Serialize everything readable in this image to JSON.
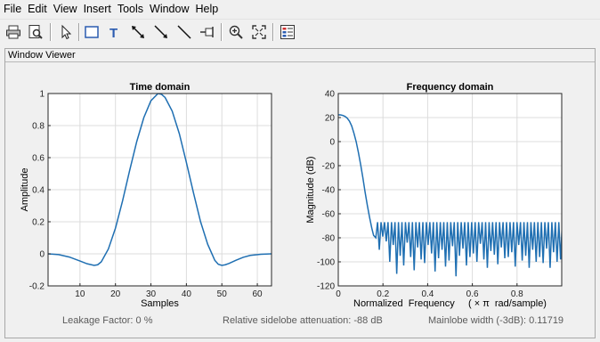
{
  "menu": [
    "File",
    "Edit",
    "View",
    "Insert",
    "Tools",
    "Window",
    "Help"
  ],
  "toolbar": {
    "icons": [
      "print-icon",
      "print-preview-icon",
      "pointer-icon",
      "rectangle-icon",
      "text-icon",
      "double-arrow-icon",
      "arrow-icon",
      "line-icon",
      "pin-icon",
      "zoom-in-icon",
      "fit-icon",
      "legend-icon"
    ],
    "colors": {
      "accent": "#2b5cb0",
      "legend_red": "#d03030"
    }
  },
  "panel": {
    "title": "Window Viewer"
  },
  "status": {
    "leakage": "Leakage Factor: 0 %",
    "sidelobe": "Relative sidelobe attenuation: -88 dB",
    "mainlobe": "Mainlobe width (-3dB): 0.11719"
  },
  "chart_data": [
    {
      "type": "line",
      "title": "Time domain",
      "xlabel": "Samples",
      "ylabel": "Amplitude",
      "xlim": [
        1,
        64
      ],
      "ylim": [
        -0.2,
        1
      ],
      "xticks": [
        10,
        20,
        30,
        40,
        50,
        60
      ],
      "xtick_labels": [
        "10",
        "20",
        "30",
        "40",
        "50",
        "60"
      ],
      "yticks": [
        -0.2,
        0,
        0.2,
        0.4,
        0.6,
        0.8,
        1
      ],
      "ytick_labels": [
        "-0.2",
        "0",
        "0.2",
        "0.4",
        "0.6",
        "0.8",
        "1"
      ],
      "grid": true,
      "color": "#1f6fb2",
      "x": [
        1,
        4,
        7,
        10,
        12,
        14,
        15,
        16,
        18,
        20,
        22,
        24,
        26,
        28,
        30,
        32,
        33,
        34,
        36,
        38,
        40,
        42,
        44,
        46,
        48,
        49,
        50,
        51,
        52,
        54,
        56,
        58,
        61,
        64
      ],
      "y": [
        0.0,
        -0.005,
        -0.02,
        -0.045,
        -0.062,
        -0.072,
        -0.068,
        -0.05,
        0.03,
        0.16,
        0.33,
        0.52,
        0.7,
        0.85,
        0.955,
        1.0,
        0.995,
        0.975,
        0.89,
        0.75,
        0.57,
        0.38,
        0.2,
        0.06,
        -0.04,
        -0.065,
        -0.072,
        -0.068,
        -0.06,
        -0.04,
        -0.022,
        -0.01,
        -0.003,
        0.0
      ]
    },
    {
      "type": "line",
      "title": "Frequency domain",
      "xlabel": "Normalized  Frequency     ( × π  rad/sample)",
      "ylabel": "Magnitude (dB)",
      "xlim": [
        0,
        1
      ],
      "ylim": [
        -120,
        40
      ],
      "xticks": [
        0,
        0.2,
        0.4,
        0.6,
        0.8
      ],
      "xtick_labels": [
        "0",
        "0.2",
        "0.4",
        "0.6",
        "0.8"
      ],
      "yticks": [
        -120,
        -100,
        -80,
        -60,
        -40,
        -20,
        0,
        20,
        40
      ],
      "ytick_labels": [
        "-120",
        "-100",
        "-80",
        "-60",
        "-40",
        "-20",
        "0",
        "20",
        "40"
      ],
      "grid": true,
      "color": "#1f6fb2",
      "x": [
        0,
        0.01,
        0.02,
        0.03,
        0.04,
        0.05,
        0.06,
        0.07,
        0.08,
        0.09,
        0.1,
        0.11,
        0.12,
        0.13,
        0.14,
        0.15,
        0.158,
        0.163,
        0.168
      ],
      "y": [
        22.3,
        22.2,
        21.8,
        21,
        19.5,
        17,
        13,
        7,
        0,
        -9,
        -19,
        -30,
        -42,
        -53,
        -63,
        -72,
        -78,
        -79,
        -80
      ],
      "sidelobes": {
        "start": 0.168,
        "spacing": 0.0156,
        "peak_db": -67,
        "trough_db": [
          -90,
          -79,
          -83,
          -100,
          -86,
          -110,
          -95,
          -103,
          -84,
          -96,
          -107,
          -88,
          -98,
          -101,
          -86,
          -93,
          -108,
          -97,
          -90,
          -104,
          -99,
          -87,
          -112,
          -95,
          -89,
          -103,
          -96,
          -93,
          -100,
          -85,
          -98,
          -105,
          -91,
          -94,
          -102,
          -88,
          -97,
          -96,
          -92,
          -104,
          -86,
          -99,
          -95,
          -105,
          -90,
          -100,
          -96,
          -101,
          -89,
          -105,
          -92,
          -100,
          -98,
          -85
        ]
      }
    }
  ]
}
